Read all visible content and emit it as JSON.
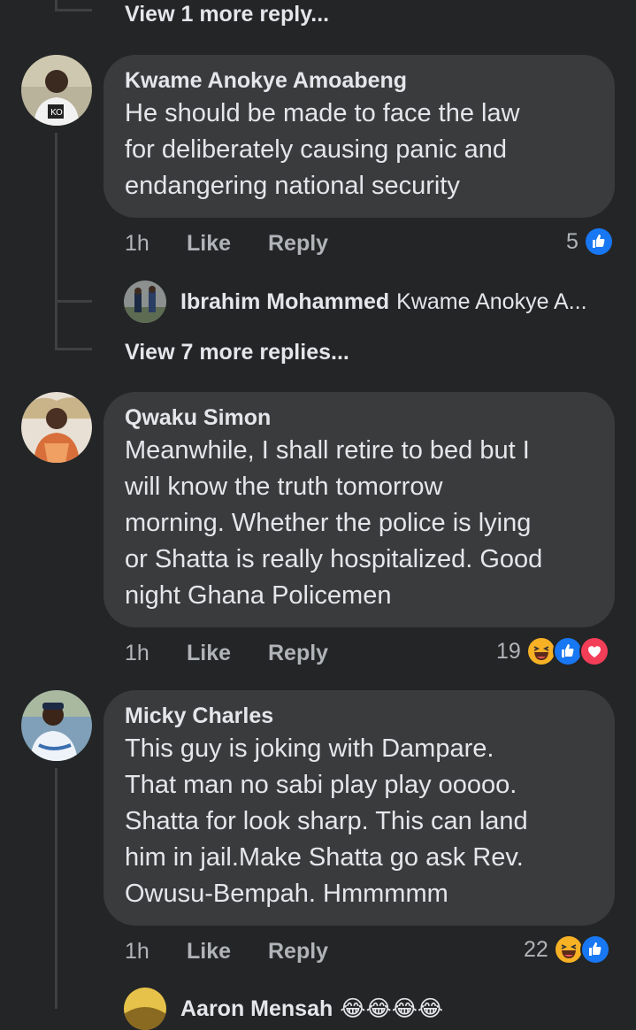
{
  "top": {
    "view_more": "View 1 more reply..."
  },
  "comments": [
    {
      "name": "Kwame Anokye Amoabeng",
      "text": "He should be made to face the law\nfor deliberately causing panic and\nendangering national security",
      "time": "1h",
      "like": "Like",
      "reply": "Reply",
      "reaction_count": "5",
      "reactions": [
        "like-icon"
      ]
    },
    {
      "name": "Qwaku Simon",
      "text": "Meanwhile, I shall retire to bed but I\nwill know the truth tomorrow\nmorning. Whether the police is lying\nor Shatta is really hospitalized. Good\nnight Ghana Policemen",
      "time": "1h",
      "like": "Like",
      "reply": "Reply",
      "reaction_count": "19",
      "reactions": [
        "haha-icon",
        "like-icon",
        "love-icon"
      ]
    },
    {
      "name": "Micky Charles",
      "text": "This guy is joking with Dampare.\nThat man no sabi play play ooooo.\nShatta for look sharp. This  can land\nhim in jail.Make Shatta go ask Rev.\nOwusu-Bempah. Hmmmmm",
      "time": "1h",
      "like": "Like",
      "reply": "Reply",
      "reaction_count": "22",
      "reactions": [
        "haha-icon",
        "like-icon"
      ]
    }
  ],
  "replies": {
    "kwame": {
      "name": "Ibrahim Mohammed",
      "text": "Kwame Anokye A...",
      "view_more": "View 7 more replies..."
    },
    "micky": {
      "name": "Aaron Mensah",
      "emoji": "😂😂😂😂"
    }
  },
  "colors": {
    "background": "#242526",
    "bubble": "#3a3b3c",
    "text": "#e4e6eb",
    "secondary": "#b0b3b8",
    "like_blue": "#1877f2",
    "love_red": "#f33e58",
    "haha_yellow": "#f7b125"
  }
}
